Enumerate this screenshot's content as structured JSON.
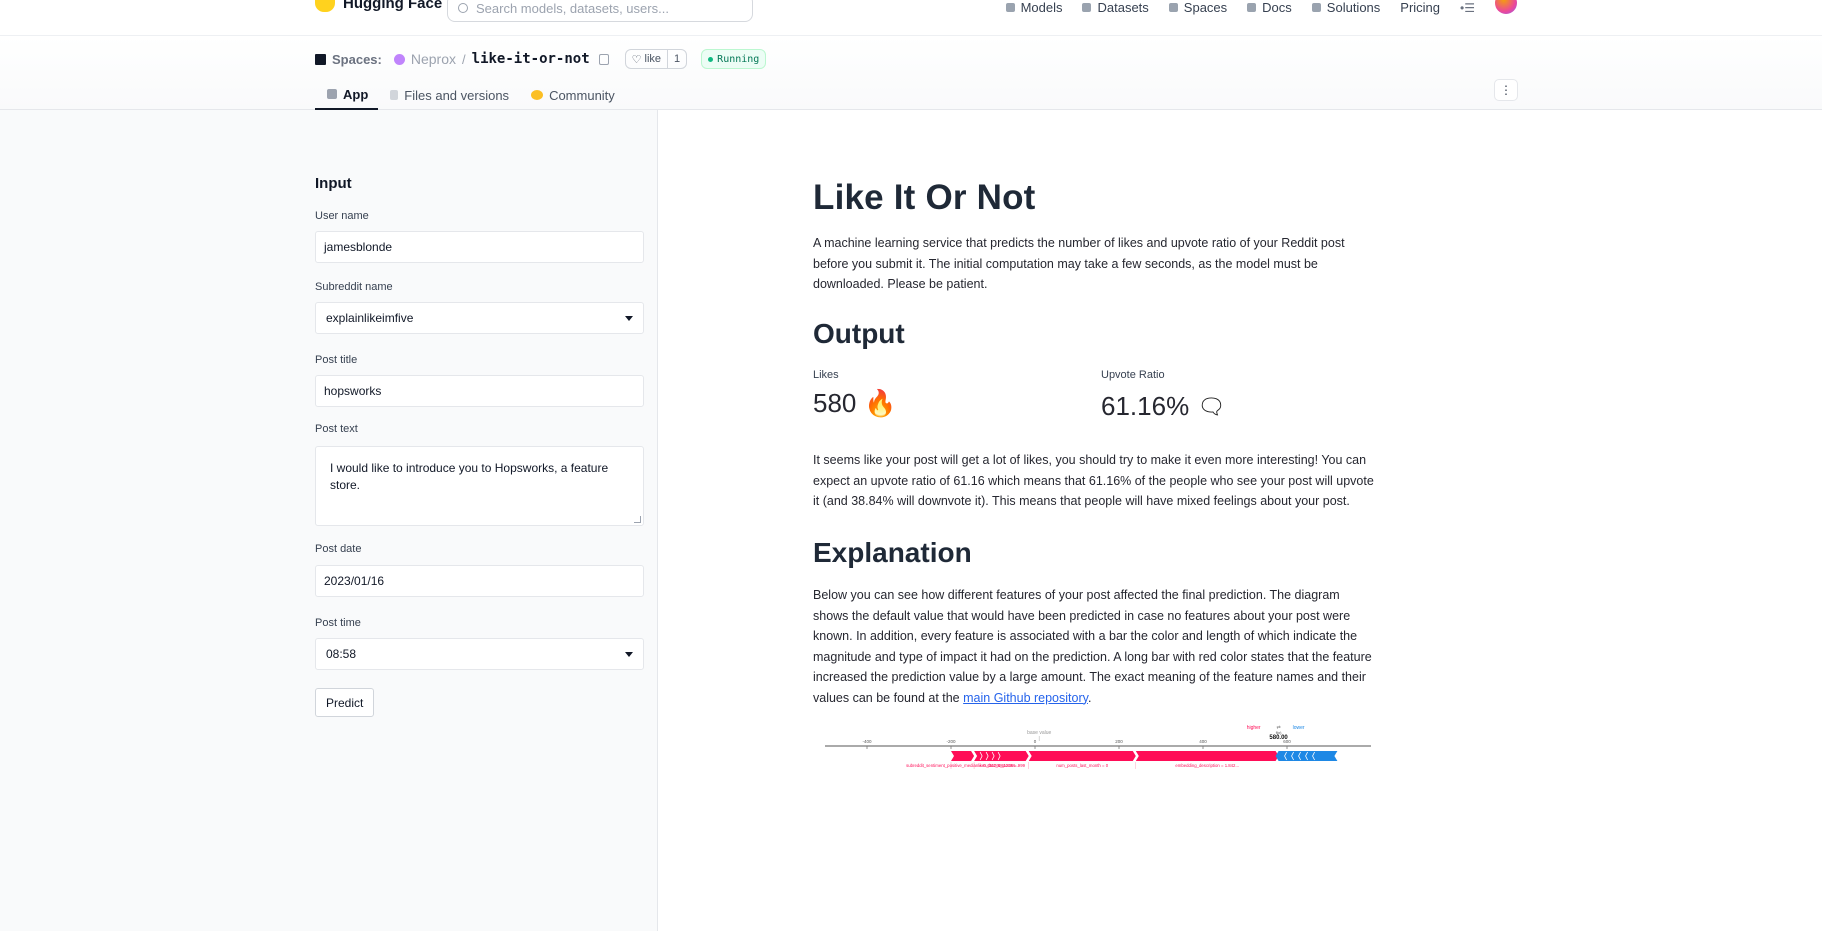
{
  "nav": {
    "brand": "Hugging Face",
    "search_placeholder": "Search models, datasets, users...",
    "links": [
      "Models",
      "Datasets",
      "Spaces",
      "Docs",
      "Solutions",
      "Pricing"
    ]
  },
  "space": {
    "section": "Spaces:",
    "org": "Neprox",
    "name": "like-it-or-not",
    "like_label": "like",
    "like_count": "1",
    "status": "Running",
    "tabs": [
      "App",
      "Files and versions",
      "Community"
    ]
  },
  "input": {
    "title": "Input",
    "username_label": "User name",
    "username_value": "jamesblonde",
    "subreddit_label": "Subreddit name",
    "subreddit_value": "explainlikeimfive",
    "post_title_label": "Post title",
    "post_title_value": "hopsworks",
    "post_text_label": "Post text",
    "post_text_value": "I would like to introduce you to Hopsworks, a feature store.",
    "post_date_label": "Post date",
    "post_date_value": "2023/01/16",
    "post_time_label": "Post time",
    "post_time_value": "08:58",
    "predict_label": "Predict"
  },
  "main": {
    "title": "Like It Or Not",
    "intro": "A machine learning service that predicts the number of likes and upvote ratio of your Reddit post before you submit it. The initial computation may take a few seconds, as the model must be downloaded. Please be patient.",
    "output_heading": "Output",
    "likes_label": "Likes",
    "likes_value": "580",
    "likes_emoji": "🔥",
    "upvote_label": "Upvote Ratio",
    "upvote_value": "61.16%",
    "upvote_emoji": "🗨",
    "output_text": "It seems like your post will get a lot of likes, you should try to make it even more interesting! You can expect an upvote ratio of 61.16 which means that 61.16% of the people who see your post will upvote it (and 38.84% will downvote it). This means that people will have mixed feelings about your post.",
    "explanation_heading": "Explanation",
    "explanation_text": "Below you can see how different features of your post affected the final prediction. The diagram shows the default value that would have been predicted in case no features about your post were known. In addition, every feature is associated with a bar the color and length of which indicate the magnitude and type of impact it had on the prediction. A long bar with red color states that the feature increased the prediction value by a large amount. The exact meaning of the feature names and their values can be found at the",
    "explanation_link": "main Github repository",
    "explanation_end": "."
  },
  "chart_data": {
    "type": "bar",
    "title": "",
    "base_value_label": "base value",
    "higher_label": "higher",
    "arrow_label": "⇄",
    "lower_label": "lower",
    "output_label": "f(x)",
    "output_value": "580.00",
    "ticks": [
      -400,
      -200,
      0,
      200,
      400,
      600
    ],
    "xlim": [
      -500,
      800
    ],
    "base_value": 10,
    "positive": [
      {
        "feature": "subreddit_sentiment_positive_median = 0.431260612366...",
        "from": -200,
        "to": -145
      },
      {
        "feature": "likes_last_5_posts = 999",
        "from": -145,
        "to": -15
      },
      {
        "feature": "num_posts_last_month = 0",
        "from": -15,
        "to": 240
      },
      {
        "feature": "embedding_description = 1.842...",
        "from": 240,
        "to": 580
      }
    ],
    "negative": [
      {
        "from": 580,
        "to": 720
      }
    ],
    "colors": {
      "positive": "#ff0d57",
      "negative": "#1e88e5"
    }
  }
}
